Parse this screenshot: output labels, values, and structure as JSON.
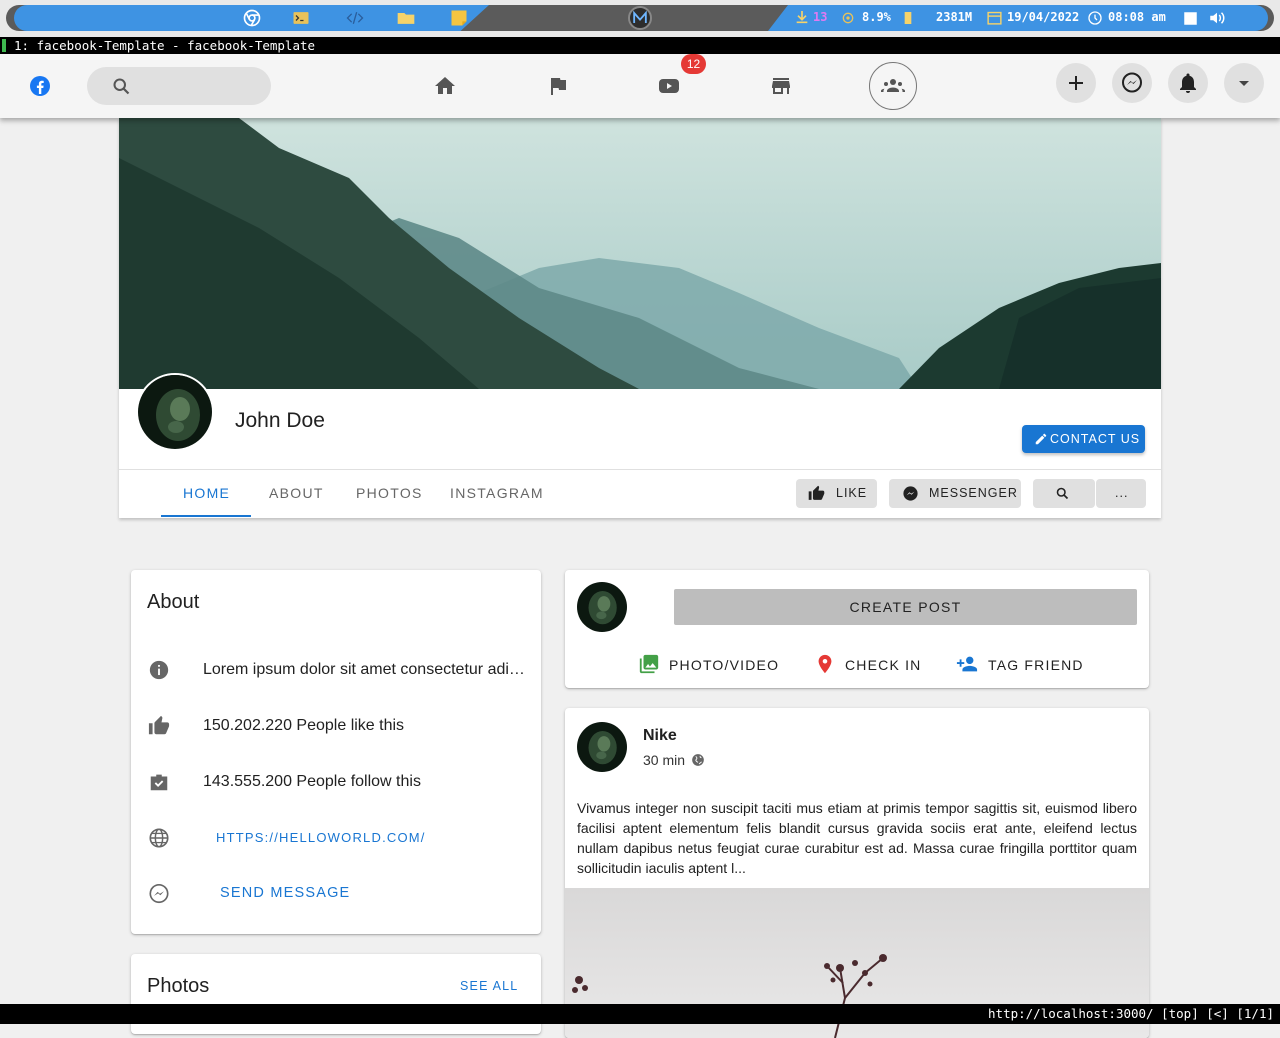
{
  "system_bar": {
    "downloads": "13",
    "cpu": "8.9%",
    "memory": "2381M",
    "date": "19/04/2022",
    "time": "08:08 am"
  },
  "terminal": {
    "title": "1: facebook-Template - facebook-Template"
  },
  "appbar": {
    "video_badge": "12"
  },
  "profile": {
    "name": "John Doe",
    "contact_label": "CONTACT US"
  },
  "tabs": [
    {
      "label": "HOME",
      "active": true
    },
    {
      "label": "ABOUT"
    },
    {
      "label": "PHOTOS"
    },
    {
      "label": "INSTAGRAM"
    }
  ],
  "actions": {
    "like": "LIKE",
    "messenger": "MESSENGER",
    "more": "..."
  },
  "about": {
    "title": "About",
    "description": "Lorem ipsum dolor sit amet consectetur adipisicing elit",
    "likes": "150.202.220 People like this",
    "follows": "143.555.200 People follow this",
    "website": "HTTPS://HELLOWORLD.COM/",
    "send_message": "SEND MESSAGE"
  },
  "photos": {
    "title": "Photos",
    "see_all": "SEE ALL"
  },
  "create_post": {
    "button": "CREATE POST",
    "photo_video": "PHOTO/VIDEO",
    "check_in": "CHECK IN",
    "tag_friend": "TAG FRIEND"
  },
  "post": {
    "author": "Nike",
    "time": "30 min",
    "text": "Vivamus integer non suscipit taciti mus etiam at primis tempor sagittis sit, euismod libero facilisi aptent elementum felis blandit cursus gravida sociis erat ante, eleifend lectus nullam dapibus netus feugiat curae curabitur est ad. Massa curae fringilla porttitor quam sollicitudin iaculis aptent l..."
  },
  "statusbar": {
    "url": "http://localhost:3000/ [top] [<] [1/1]"
  },
  "colors": {
    "primary": "#1976d2",
    "badge": "#e53935",
    "facebook": "#1877f2",
    "photo_icon": "#43a047",
    "checkin_icon": "#e53935",
    "tag_icon": "#1976d2"
  }
}
